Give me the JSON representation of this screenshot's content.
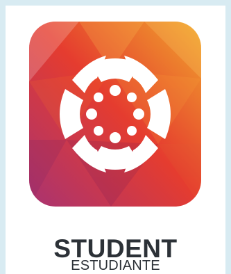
{
  "app": {
    "icon_name": "canvas-student-logo-icon",
    "title": "STUDENT",
    "subtitle": "ESTUDIANTE"
  },
  "colors": {
    "background": "#d8ebf2",
    "panel": "#ffffff",
    "gradient_start": "#f0a02a",
    "gradient_mid": "#e5392e",
    "gradient_end": "#b63a6b",
    "text": "#2c3137"
  }
}
